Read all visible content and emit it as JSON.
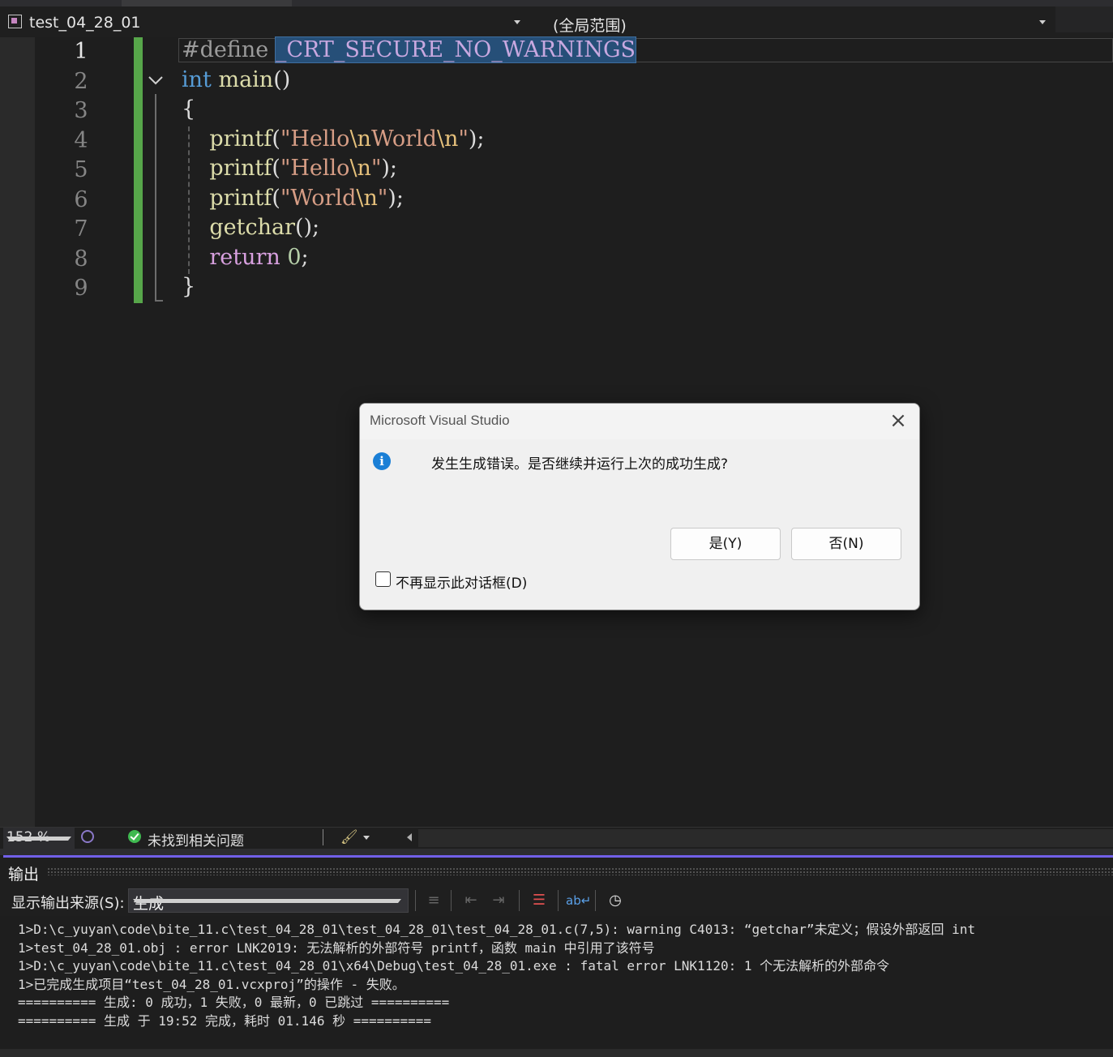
{
  "nav": {
    "file_combo": "test_04_28_01",
    "scope_combo": "(全局范围)"
  },
  "editor": {
    "line_numbers": [
      "1",
      "2",
      "3",
      "4",
      "5",
      "6",
      "7",
      "8",
      "9"
    ],
    "lines": [
      {
        "parts": [
          {
            "t": "#define ",
            "c": "pp"
          },
          {
            "t": "_CRT_SECURE_NO_WARNINGS",
            "c": "macro sel"
          }
        ]
      },
      {
        "parts": [
          {
            "t": "int",
            "c": "kw"
          },
          {
            "t": " ",
            "c": ""
          },
          {
            "t": "main",
            "c": "fn"
          },
          {
            "t": "()",
            "c": ""
          }
        ]
      },
      {
        "parts": [
          {
            "t": "{",
            "c": ""
          }
        ]
      },
      {
        "parts": [
          {
            "t": "    ",
            "c": ""
          },
          {
            "t": "printf",
            "c": "fn"
          },
          {
            "t": "(",
            "c": ""
          },
          {
            "t": "\"Hello",
            "c": "str"
          },
          {
            "t": "\\n",
            "c": "esc"
          },
          {
            "t": "World",
            "c": "str"
          },
          {
            "t": "\\n",
            "c": "esc"
          },
          {
            "t": "\"",
            "c": "str"
          },
          {
            "t": ");",
            "c": ""
          }
        ]
      },
      {
        "parts": [
          {
            "t": "    ",
            "c": ""
          },
          {
            "t": "printf",
            "c": "fn"
          },
          {
            "t": "(",
            "c": ""
          },
          {
            "t": "\"Hello",
            "c": "str"
          },
          {
            "t": "\\n",
            "c": "esc"
          },
          {
            "t": "\"",
            "c": "str"
          },
          {
            "t": ");",
            "c": ""
          }
        ]
      },
      {
        "parts": [
          {
            "t": "    ",
            "c": ""
          },
          {
            "t": "printf",
            "c": "fn"
          },
          {
            "t": "(",
            "c": ""
          },
          {
            "t": "\"World",
            "c": "str"
          },
          {
            "t": "\\n",
            "c": "esc"
          },
          {
            "t": "\"",
            "c": "str"
          },
          {
            "t": ");",
            "c": ""
          }
        ]
      },
      {
        "parts": [
          {
            "t": "    ",
            "c": ""
          },
          {
            "t": "getchar",
            "c": "fn"
          },
          {
            "t": "();",
            "c": ""
          }
        ]
      },
      {
        "parts": [
          {
            "t": "    ",
            "c": ""
          },
          {
            "t": "return",
            "c": "kw2"
          },
          {
            "t": " ",
            "c": ""
          },
          {
            "t": "0",
            "c": "num"
          },
          {
            "t": ";",
            "c": ""
          }
        ]
      },
      {
        "parts": [
          {
            "t": "}",
            "c": ""
          }
        ]
      }
    ],
    "current_line": 1
  },
  "editor_status": {
    "zoom": "152 %",
    "issues": "未找到相关问题"
  },
  "output": {
    "title": "输出",
    "source_label": "显示输出来源(S):",
    "source_value": "生成",
    "lines": [
      "1>D:\\c_yuyan\\code\\bite_11.c\\test_04_28_01\\test_04_28_01\\test_04_28_01.c(7,5): warning C4013: “getchar”未定义；假设外部返回 int",
      "1>test_04_28_01.obj : error LNK2019: 无法解析的外部符号 printf，函数 main 中引用了该符号",
      "1>D:\\c_yuyan\\code\\bite_11.c\\test_04_28_01\\x64\\Debug\\test_04_28_01.exe : fatal error LNK1120: 1 个无法解析的外部命令",
      "1>已完成生成项目“test_04_28_01.vcxproj”的操作 - 失败。",
      "========== 生成: 0 成功，1 失败，0 最新，0 已跳过 ==========",
      "========== 生成 于 19:52 完成，耗时 01.146 秒 =========="
    ]
  },
  "dialog": {
    "title": "Microsoft Visual Studio",
    "message": "发生生成错误。是否继续并运行上次的成功生成?",
    "yes_label": "是(Y)",
    "no_label": "否(N)",
    "checkbox_label": "不再显示此对话框(D)",
    "checkbox_checked": false,
    "icon": "info-icon"
  }
}
